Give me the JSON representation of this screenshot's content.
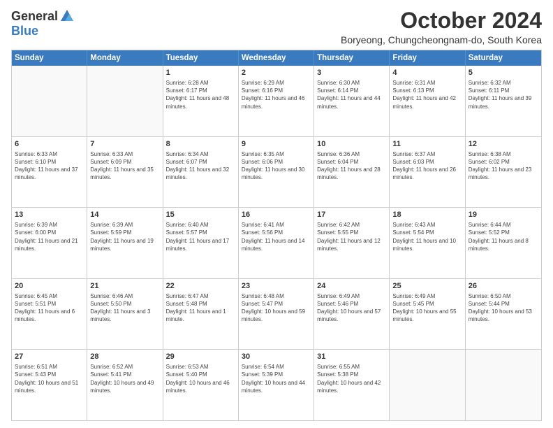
{
  "logo": {
    "general": "General",
    "blue": "Blue"
  },
  "header": {
    "month": "October 2024",
    "location": "Boryeong, Chungcheongnam-do, South Korea"
  },
  "weekdays": [
    "Sunday",
    "Monday",
    "Tuesday",
    "Wednesday",
    "Thursday",
    "Friday",
    "Saturday"
  ],
  "rows": [
    [
      {
        "day": "",
        "lines": []
      },
      {
        "day": "",
        "lines": []
      },
      {
        "day": "1",
        "lines": [
          "Sunrise: 6:28 AM",
          "Sunset: 6:17 PM",
          "Daylight: 11 hours and 48 minutes."
        ]
      },
      {
        "day": "2",
        "lines": [
          "Sunrise: 6:29 AM",
          "Sunset: 6:16 PM",
          "Daylight: 11 hours and 46 minutes."
        ]
      },
      {
        "day": "3",
        "lines": [
          "Sunrise: 6:30 AM",
          "Sunset: 6:14 PM",
          "Daylight: 11 hours and 44 minutes."
        ]
      },
      {
        "day": "4",
        "lines": [
          "Sunrise: 6:31 AM",
          "Sunset: 6:13 PM",
          "Daylight: 11 hours and 42 minutes."
        ]
      },
      {
        "day": "5",
        "lines": [
          "Sunrise: 6:32 AM",
          "Sunset: 6:11 PM",
          "Daylight: 11 hours and 39 minutes."
        ]
      }
    ],
    [
      {
        "day": "6",
        "lines": [
          "Sunrise: 6:33 AM",
          "Sunset: 6:10 PM",
          "Daylight: 11 hours and 37 minutes."
        ]
      },
      {
        "day": "7",
        "lines": [
          "Sunrise: 6:33 AM",
          "Sunset: 6:09 PM",
          "Daylight: 11 hours and 35 minutes."
        ]
      },
      {
        "day": "8",
        "lines": [
          "Sunrise: 6:34 AM",
          "Sunset: 6:07 PM",
          "Daylight: 11 hours and 32 minutes."
        ]
      },
      {
        "day": "9",
        "lines": [
          "Sunrise: 6:35 AM",
          "Sunset: 6:06 PM",
          "Daylight: 11 hours and 30 minutes."
        ]
      },
      {
        "day": "10",
        "lines": [
          "Sunrise: 6:36 AM",
          "Sunset: 6:04 PM",
          "Daylight: 11 hours and 28 minutes."
        ]
      },
      {
        "day": "11",
        "lines": [
          "Sunrise: 6:37 AM",
          "Sunset: 6:03 PM",
          "Daylight: 11 hours and 26 minutes."
        ]
      },
      {
        "day": "12",
        "lines": [
          "Sunrise: 6:38 AM",
          "Sunset: 6:02 PM",
          "Daylight: 11 hours and 23 minutes."
        ]
      }
    ],
    [
      {
        "day": "13",
        "lines": [
          "Sunrise: 6:39 AM",
          "Sunset: 6:00 PM",
          "Daylight: 11 hours and 21 minutes."
        ]
      },
      {
        "day": "14",
        "lines": [
          "Sunrise: 6:39 AM",
          "Sunset: 5:59 PM",
          "Daylight: 11 hours and 19 minutes."
        ]
      },
      {
        "day": "15",
        "lines": [
          "Sunrise: 6:40 AM",
          "Sunset: 5:57 PM",
          "Daylight: 11 hours and 17 minutes."
        ]
      },
      {
        "day": "16",
        "lines": [
          "Sunrise: 6:41 AM",
          "Sunset: 5:56 PM",
          "Daylight: 11 hours and 14 minutes."
        ]
      },
      {
        "day": "17",
        "lines": [
          "Sunrise: 6:42 AM",
          "Sunset: 5:55 PM",
          "Daylight: 11 hours and 12 minutes."
        ]
      },
      {
        "day": "18",
        "lines": [
          "Sunrise: 6:43 AM",
          "Sunset: 5:54 PM",
          "Daylight: 11 hours and 10 minutes."
        ]
      },
      {
        "day": "19",
        "lines": [
          "Sunrise: 6:44 AM",
          "Sunset: 5:52 PM",
          "Daylight: 11 hours and 8 minutes."
        ]
      }
    ],
    [
      {
        "day": "20",
        "lines": [
          "Sunrise: 6:45 AM",
          "Sunset: 5:51 PM",
          "Daylight: 11 hours and 6 minutes."
        ]
      },
      {
        "day": "21",
        "lines": [
          "Sunrise: 6:46 AM",
          "Sunset: 5:50 PM",
          "Daylight: 11 hours and 3 minutes."
        ]
      },
      {
        "day": "22",
        "lines": [
          "Sunrise: 6:47 AM",
          "Sunset: 5:48 PM",
          "Daylight: 11 hours and 1 minute."
        ]
      },
      {
        "day": "23",
        "lines": [
          "Sunrise: 6:48 AM",
          "Sunset: 5:47 PM",
          "Daylight: 10 hours and 59 minutes."
        ]
      },
      {
        "day": "24",
        "lines": [
          "Sunrise: 6:49 AM",
          "Sunset: 5:46 PM",
          "Daylight: 10 hours and 57 minutes."
        ]
      },
      {
        "day": "25",
        "lines": [
          "Sunrise: 6:49 AM",
          "Sunset: 5:45 PM",
          "Daylight: 10 hours and 55 minutes."
        ]
      },
      {
        "day": "26",
        "lines": [
          "Sunrise: 6:50 AM",
          "Sunset: 5:44 PM",
          "Daylight: 10 hours and 53 minutes."
        ]
      }
    ],
    [
      {
        "day": "27",
        "lines": [
          "Sunrise: 6:51 AM",
          "Sunset: 5:43 PM",
          "Daylight: 10 hours and 51 minutes."
        ]
      },
      {
        "day": "28",
        "lines": [
          "Sunrise: 6:52 AM",
          "Sunset: 5:41 PM",
          "Daylight: 10 hours and 49 minutes."
        ]
      },
      {
        "day": "29",
        "lines": [
          "Sunrise: 6:53 AM",
          "Sunset: 5:40 PM",
          "Daylight: 10 hours and 46 minutes."
        ]
      },
      {
        "day": "30",
        "lines": [
          "Sunrise: 6:54 AM",
          "Sunset: 5:39 PM",
          "Daylight: 10 hours and 44 minutes."
        ]
      },
      {
        "day": "31",
        "lines": [
          "Sunrise: 6:55 AM",
          "Sunset: 5:38 PM",
          "Daylight: 10 hours and 42 minutes."
        ]
      },
      {
        "day": "",
        "lines": []
      },
      {
        "day": "",
        "lines": []
      }
    ]
  ]
}
